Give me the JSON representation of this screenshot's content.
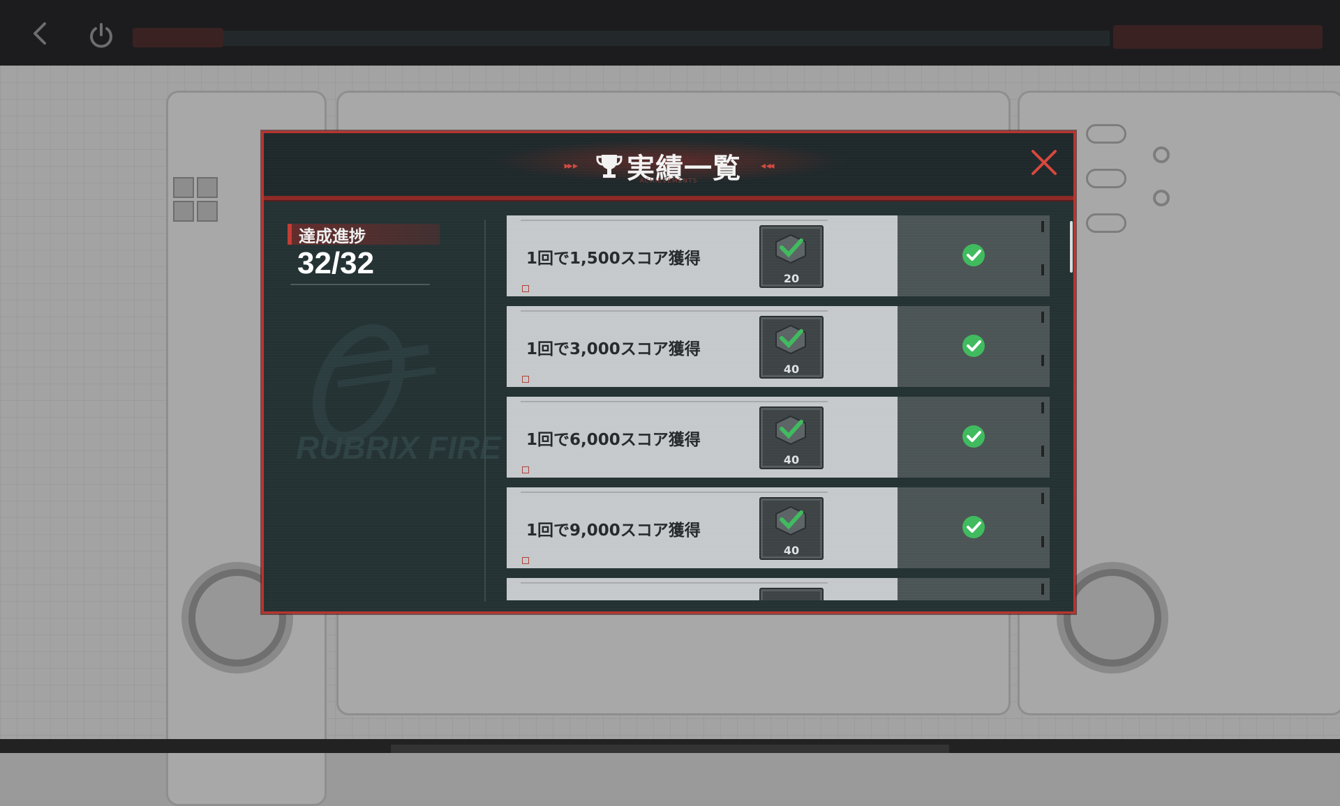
{
  "modal": {
    "title": "実績一覧",
    "subtitle": "ACHIEVEMENTS",
    "icons": {
      "title": "trophy-icon",
      "close": "close-icon"
    }
  },
  "progress": {
    "label": "達成進捗",
    "value": "32/32"
  },
  "achievements": [
    {
      "label": "1回で1,500スコア獲得",
      "reward": "20",
      "completed": true
    },
    {
      "label": "1回で3,000スコア獲得",
      "reward": "40",
      "completed": true
    },
    {
      "label": "1回で6,000スコア獲得",
      "reward": "40",
      "completed": true
    },
    {
      "label": "1回で9,000スコア獲得",
      "reward": "40",
      "completed": true
    },
    {
      "label": "",
      "reward": "",
      "completed": true
    }
  ],
  "background": {
    "watermark": "RUBRIX FIRE",
    "icons": {
      "back": "back-arrow-icon",
      "power": "power-icon"
    }
  },
  "colors": {
    "accent": "#c13c35",
    "modal_bg": "#243234",
    "check": "#3fbb5e"
  }
}
